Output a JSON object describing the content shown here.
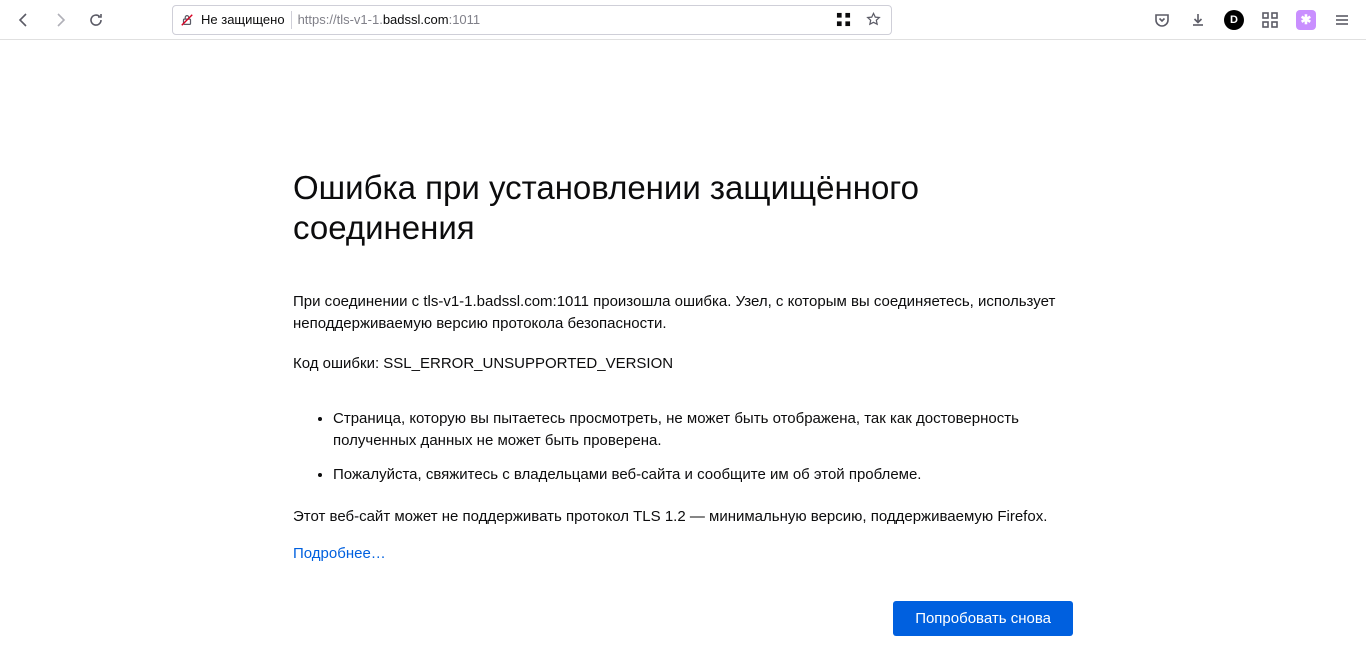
{
  "toolbar": {
    "security_label": "Не защищено",
    "url_pre": "https://tls-v1-1.",
    "url_host": "badssl.com",
    "url_post": ":1011",
    "ext_letter": "D",
    "ext_purple_glyph": "✱"
  },
  "error": {
    "title": "Ошибка при установлении защищённого соединения",
    "description": "При соединении с tls-v1-1.badssl.com:1011 произошла ошибка. Узел, с которым вы соединяетесь, использует неподдерживаемую версию протокола безопасности.",
    "code_label": "Код ошибки: SSL_ERROR_UNSUPPORTED_VERSION",
    "bullets": [
      "Страница, которую вы пытаетесь просмотреть, не может быть отображена, так как достоверность полученных данных не может быть проверена.",
      "Пожалуйста, свяжитесь с владельцами веб-сайта и сообщите им об этой проблеме."
    ],
    "tls_note": "Этот веб-сайт может не поддерживать протокол TLS 1.2 — минимальную версию, поддерживаемую Firefox.",
    "learn_more": "Подробнее…",
    "retry_button": "Попробовать снова"
  }
}
